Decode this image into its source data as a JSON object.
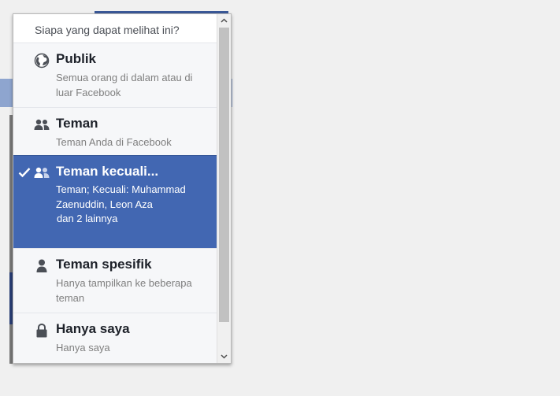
{
  "header": {
    "title": "Siapa yang dapat melihat ini?"
  },
  "options": [
    {
      "name": "Publik",
      "desc": "Semua orang di dalam atau di luar Facebook",
      "icon": "globe-icon",
      "selected": false
    },
    {
      "name": "Teman",
      "desc": "Teman Anda di Facebook",
      "icon": "friends-icon",
      "selected": false
    },
    {
      "name": "Teman kecuali...",
      "desc": "Teman; Kecuali: Muhammad Zaenuddin, Leon Aza",
      "desc2": "dan 2 lainnya",
      "icon": "friends-except-icon",
      "selected": true
    },
    {
      "name": "Teman spesifik",
      "desc": "Hanya tampilkan ke beberapa teman",
      "icon": "person-icon",
      "selected": false
    },
    {
      "name": "Hanya saya",
      "desc": "Hanya saya",
      "icon": "lock-icon",
      "selected": false
    }
  ],
  "colors": {
    "selected_bg": "#4267b2",
    "facebook_blue": "#3b5998"
  }
}
